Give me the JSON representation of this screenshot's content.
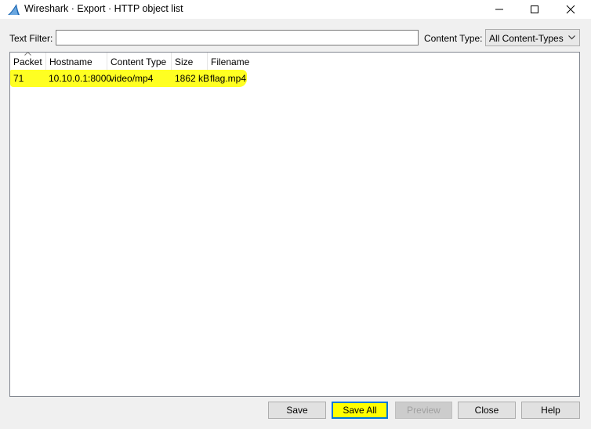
{
  "window": {
    "title": "Wireshark · Export · HTTP object list",
    "icon": "wireshark-fin-icon"
  },
  "titlebar_buttons": {
    "minimize": "minimize-icon",
    "maximize": "maximize-icon",
    "close": "close-icon"
  },
  "filter": {
    "label": "Text Filter:",
    "value": ""
  },
  "content_type": {
    "label": "Content Type:",
    "selected": "All Content-Types"
  },
  "table": {
    "columns": [
      "Packet",
      "Hostname",
      "Content Type",
      "Size",
      "Filename"
    ],
    "sorted_column": "Packet",
    "rows": [
      {
        "packet": "71",
        "hostname": "10.10.0.1:8000",
        "content_type": "video/mp4",
        "size": "1862 kB",
        "filename": "flag.mp4"
      }
    ]
  },
  "buttons": {
    "save": "Save",
    "save_all": "Save All",
    "preview": "Preview",
    "close": "Close",
    "help": "Help"
  },
  "colors": {
    "highlight": "#ffff22",
    "focus_border": "#0078d7",
    "window_bg": "#f0f0f0",
    "wireshark_blue": "#1f69b4"
  }
}
